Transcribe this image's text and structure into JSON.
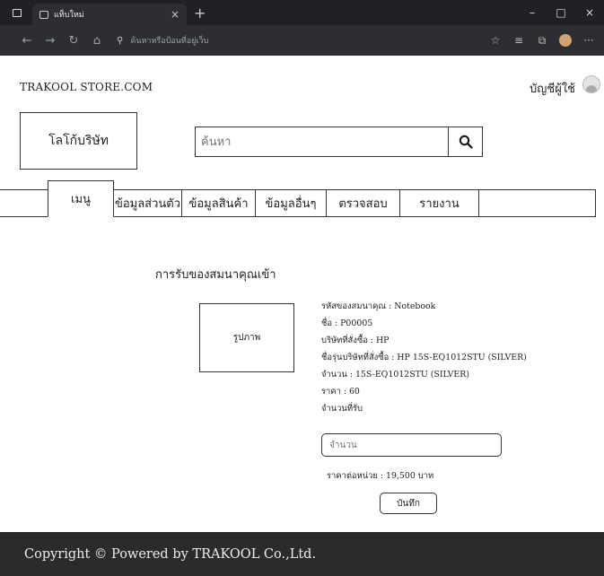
{
  "browser": {
    "tab_title": "แท็บใหม่",
    "tab_close": "×",
    "new_tab": "+",
    "window_controls": [
      "–",
      "□",
      "×"
    ],
    "address_placeholder": "ค้นหาหรือป้อนที่อยู่เว็บ",
    "icons": [
      "back-icon",
      "forward-icon",
      "reload-icon",
      "home-icon",
      "search-icon",
      "favorites-icon",
      "collections-icon",
      "profile-icon",
      "more-icon"
    ]
  },
  "header": {
    "store_name": "TRAKOOL STORE.COM",
    "account_label": "บัญชีผู้ใช้",
    "logo_label": "โลโก้บริษัท",
    "search_placeholder": "ค้นหา"
  },
  "menu": {
    "items": [
      {
        "label": "เมนู",
        "active": true
      },
      {
        "label": "ข้อมูลส่วนตัว"
      },
      {
        "label": "ข้อมูลสินค้า"
      },
      {
        "label": "ข้อมูลอื่นๆ"
      },
      {
        "label": "ตรวจสอบ"
      },
      {
        "label": "รายงาน"
      }
    ]
  },
  "main": {
    "title": "การรับของสมนาคุณเข้า",
    "image_label": "รูปภาพ",
    "details": [
      "รหัสของสมนาคุณ : Notebook",
      "ชื่อ : P00005",
      "บริษัทที่สั่งซื้อ : HP",
      "ชื่อรุ่นบริษัทที่สั่งซื้อ : HP 15S-EQ1012STU (SILVER)",
      "จำนวน : 15S-EQ1012STU (SILVER)",
      "ราคา : 60",
      "จำนวนที่รับ"
    ],
    "qty_placeholder": "จำนวน",
    "unit_price": "ราคาต่อหน่วย : 19,500 บาท",
    "save_label": "บันทึก"
  },
  "footer": {
    "text": "Copyright © Powered by TRAKOOL Co.,Ltd."
  }
}
